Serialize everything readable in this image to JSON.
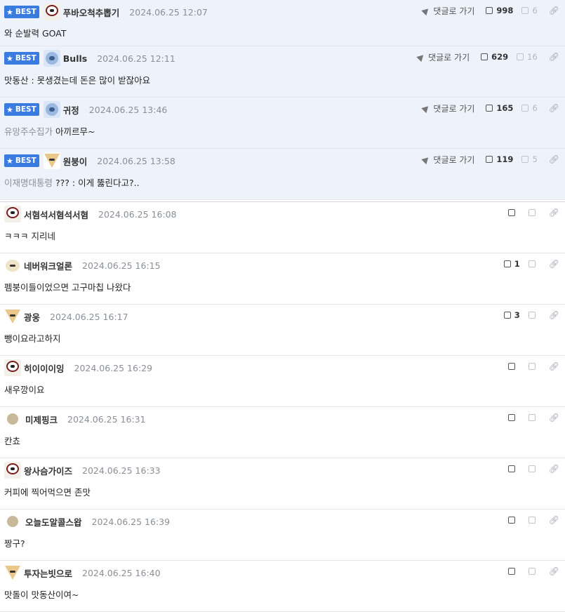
{
  "comments": [
    {
      "best": true,
      "badge": "BEST",
      "avatar": "dog-avatar",
      "nick": "푸바오척추뽑기",
      "date": "2024.06.25 12:07",
      "tag": "",
      "text": "와 순발력 GOAT",
      "goto": "댓글로 가기",
      "up": "998",
      "down": "6"
    },
    {
      "best": true,
      "badge": "BEST",
      "avatar": "blue-avatar",
      "nick": "Bulls",
      "date": "2024.06.25 12:11",
      "tag": "",
      "text": "맛동산 : 못생겼는데 돈은 많이 받잖아요",
      "goto": "댓글로 가기",
      "up": "629",
      "down": "16"
    },
    {
      "best": true,
      "badge": "BEST",
      "avatar": "blue-avatar",
      "nick": "귀정",
      "date": "2024.06.25 13:46",
      "tag": "유망주수집가",
      "text": "아끼르무~",
      "goto": "댓글로 가기",
      "up": "165",
      "down": "6"
    },
    {
      "best": true,
      "badge": "BEST",
      "avatar": "fox-avatar",
      "nick": "원붕이",
      "date": "2024.06.25 13:58",
      "tag": "이재명대통령",
      "text": "??? : 이게 뚫린다고?..",
      "goto": "댓글로 가기",
      "up": "119",
      "down": "5"
    },
    {
      "best": false,
      "avatar": "dog-avatar",
      "nick": "서혐석서혐석서혐",
      "date": "2024.06.25 16:08",
      "tag": "",
      "text": "ㅋㅋㅋ 지리네",
      "up": "",
      "down": ""
    },
    {
      "best": false,
      "avatar": "puppy-avatar",
      "nick": "네버워크얼론",
      "date": "2024.06.25 16:15",
      "tag": "",
      "text": "펨붕이들이었으면 고구마칩 나왔다",
      "up": "1",
      "down": ""
    },
    {
      "best": false,
      "avatar": "fox-avatar",
      "nick": "광웅",
      "date": "2024.06.25 16:17",
      "tag": "",
      "text": "뺑이요라고하지",
      "up": "3",
      "down": ""
    },
    {
      "best": false,
      "avatar": "dog-avatar",
      "nick": "히이이이잉",
      "date": "2024.06.25 16:29",
      "tag": "",
      "text": "새우깡이요",
      "up": "",
      "down": ""
    },
    {
      "best": false,
      "avatar": "dot-avatar",
      "nick": "미제핑크",
      "date": "2024.06.25 16:31",
      "tag": "",
      "text": "칸쵸",
      "up": "",
      "down": ""
    },
    {
      "best": false,
      "avatar": "dog-avatar",
      "nick": "왕사슴가이즈",
      "date": "2024.06.25 16:33",
      "tag": "",
      "text": "커피에 찍어먹으면 존맛",
      "up": "",
      "down": ""
    },
    {
      "best": false,
      "avatar": "dot-avatar",
      "nick": "오늘도알콜스왑",
      "date": "2024.06.25 16:39",
      "tag": "",
      "text": "짱구?",
      "up": "",
      "down": ""
    },
    {
      "best": false,
      "avatar": "fox-avatar",
      "nick": "투자는빗으로",
      "date": "2024.06.25 16:40",
      "tag": "",
      "text": "맛돌이 맛동산이여~",
      "up": "",
      "down": ""
    }
  ],
  "colors": {
    "best_bg": "#eef3fb",
    "badge": "#3a7be0"
  }
}
